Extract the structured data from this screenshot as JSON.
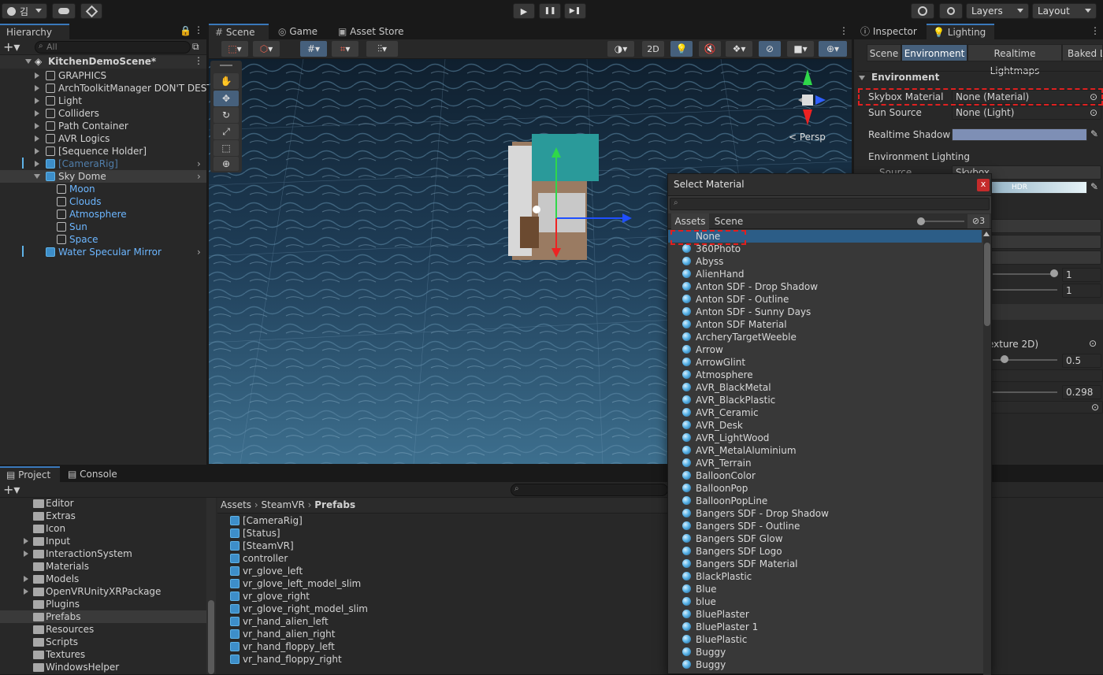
{
  "topbar": {
    "account_label": "김",
    "layers_label": "Layers",
    "layout_label": "Layout",
    "play_glyph": "▶",
    "pause_glyph": "❚❚",
    "step_glyph": "▶❚"
  },
  "hierarchy": {
    "tab_label": "Hierarchy",
    "search_placeholder": "All",
    "scene_name": "KitchenDemoScene*",
    "items": [
      {
        "label": "GRAPHICS"
      },
      {
        "label": "ArchToolkitManager DON'T DEST"
      },
      {
        "label": "Light"
      },
      {
        "label": "Colliders"
      },
      {
        "label": "Path Container"
      },
      {
        "label": "AVR Logics"
      },
      {
        "label": "[Sequence Holder]"
      },
      {
        "label": "[CameraRig]"
      },
      {
        "label": "Sky Dome"
      },
      {
        "label": "Moon"
      },
      {
        "label": "Clouds"
      },
      {
        "label": "Atmosphere"
      },
      {
        "label": "Sun"
      },
      {
        "label": "Space"
      },
      {
        "label": "Water Specular Mirror"
      }
    ]
  },
  "center_tabs": [
    "Scene",
    "Game",
    "Asset Store"
  ],
  "scene_toolbar": {
    "mode_2d": "2D",
    "persp_label": "< Persp"
  },
  "inspector": {
    "tabs": [
      "Inspector",
      "Lighting"
    ],
    "subtabs": [
      "Scene",
      "Environment",
      "Realtime Lightmaps",
      "Baked L"
    ],
    "section": "Environment",
    "skybox_label": "Skybox Material",
    "skybox_value": "None (Material)",
    "sun_label": "Sun Source",
    "sun_value": "None (Light)",
    "shadow_label": "Realtime Shadow C",
    "env_lighting_label": "Environment Lighting",
    "source_label": "Source",
    "source_value": "Skybox",
    "hdr_label": "HDR",
    "val1": "1",
    "val2": "1",
    "texture_label": "exture 2D)",
    "val3": "0.5",
    "val4": "0.298"
  },
  "project": {
    "tabs": [
      "Project",
      "Console"
    ],
    "folders": [
      {
        "label": "Editor",
        "arrow": false
      },
      {
        "label": "Extras",
        "arrow": false
      },
      {
        "label": "Icon",
        "arrow": false
      },
      {
        "label": "Input",
        "arrow": true
      },
      {
        "label": "InteractionSystem",
        "arrow": true
      },
      {
        "label": "Materials",
        "arrow": false
      },
      {
        "label": "Models",
        "arrow": true
      },
      {
        "label": "OpenVRUnityXRPackage",
        "arrow": true
      },
      {
        "label": "Plugins",
        "arrow": false
      },
      {
        "label": "Prefabs",
        "arrow": false
      },
      {
        "label": "Resources",
        "arrow": false
      },
      {
        "label": "Scripts",
        "arrow": false
      },
      {
        "label": "Textures",
        "arrow": false
      },
      {
        "label": "WindowsHelper",
        "arrow": false
      }
    ],
    "breadcrumb": [
      "Assets",
      "SteamVR",
      "Prefabs"
    ],
    "prefabs": [
      "[CameraRig]",
      "[Status]",
      "[SteamVR]",
      "controller",
      "vr_glove_left",
      "vr_glove_left_model_slim",
      "vr_glove_right",
      "vr_glove_right_model_slim",
      "vr_hand_alien_left",
      "vr_hand_alien_right",
      "vr_hand_floppy_left",
      "vr_hand_floppy_right"
    ]
  },
  "dialog": {
    "title": "Select Material",
    "close": "x",
    "tabs": [
      "Assets",
      "Scene"
    ],
    "hidden_count": "3",
    "items": [
      "None",
      "360Photo",
      "Abyss",
      "AlienHand",
      "Anton SDF - Drop Shadow",
      "Anton SDF - Outline",
      "Anton SDF - Sunny Days",
      "Anton SDF Material",
      "ArcheryTargetWeeble",
      "Arrow",
      "ArrowGlint",
      "Atmosphere",
      "AVR_BlackMetal",
      "AVR_BlackPlastic",
      "AVR_Ceramic",
      "AVR_Desk",
      "AVR_LightWood",
      "AVR_MetalAluminium",
      "AVR_Terrain",
      "BalloonColor",
      "BalloonPop",
      "BalloonPopLine",
      "Bangers SDF - Drop Shadow",
      "Bangers SDF - Outline",
      "Bangers SDF Glow",
      "Bangers SDF Logo",
      "Bangers SDF Material",
      "BlackPlastic",
      "Blue",
      "blue",
      "BluePlaster",
      "BluePlaster 1",
      "BluePlastic",
      "Buggy",
      "Buggy"
    ]
  },
  "colors": {
    "accent": "#3a79bb",
    "selection": "#2c5d87",
    "highlight": "#e02020",
    "prefab_blue": "#5fb3e8"
  }
}
